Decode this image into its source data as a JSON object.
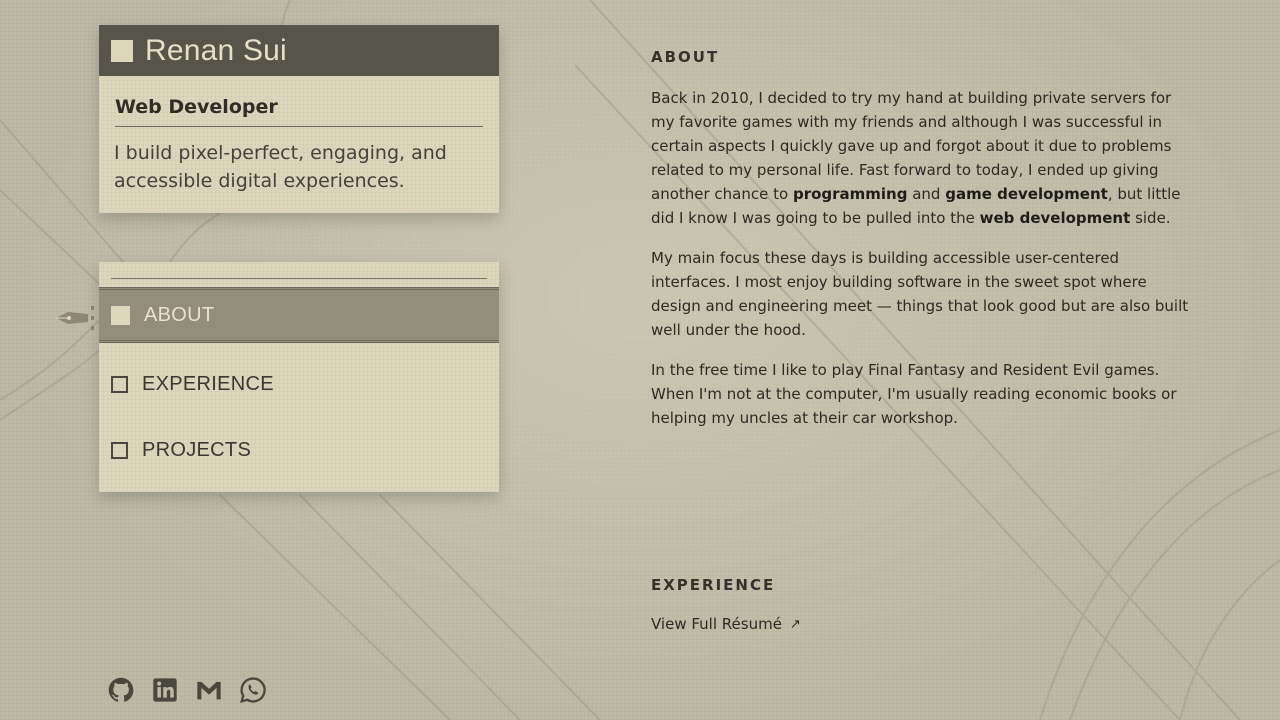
{
  "profile": {
    "name": "Renan Sui",
    "role": "Web Developer",
    "tagline": "I build pixel-perfect, engaging, and accessible digital experiences."
  },
  "nav": {
    "items": [
      {
        "label": "ABOUT",
        "active": true
      },
      {
        "label": "EXPERIENCE",
        "active": false
      },
      {
        "label": "PROJECTS",
        "active": false
      }
    ]
  },
  "about": {
    "title": "ABOUT",
    "p1": {
      "t1": "Back in 2010, I decided to try my hand at building private servers for my favorite games with my friends and although I was successful in certain aspects I quickly gave up and forgot about it due to problems related to my personal life. Fast forward to today, I ended up giving another chance to ",
      "b1": "programming",
      "t2": " and ",
      "b2": "game development",
      "t3": ", but little did I know I was going to be pulled into the ",
      "b3": "web development",
      "t4": " side."
    },
    "p2": "My main focus these days is building accessible user-centered interfaces. I most enjoy building software in the sweet spot where design and engineering meet — things that look good but are also built well under the hood.",
    "p3": "In the free time I like to play Final Fantasy and Resident Evil games. When I'm not at the computer, I'm usually reading economic books or helping my uncles at their car workshop."
  },
  "experience": {
    "title": "EXPERIENCE",
    "resume_label": "View Full Résumé",
    "arrow": "↗"
  },
  "socials": [
    "github-icon",
    "linkedin-icon",
    "gmail-icon",
    "whatsapp-icon"
  ],
  "colors": {
    "background": "#bdb9a6",
    "card": "#dcd6bb",
    "header": "#57544a",
    "active_nav": "#938d7c",
    "text": "#2c2a24"
  }
}
